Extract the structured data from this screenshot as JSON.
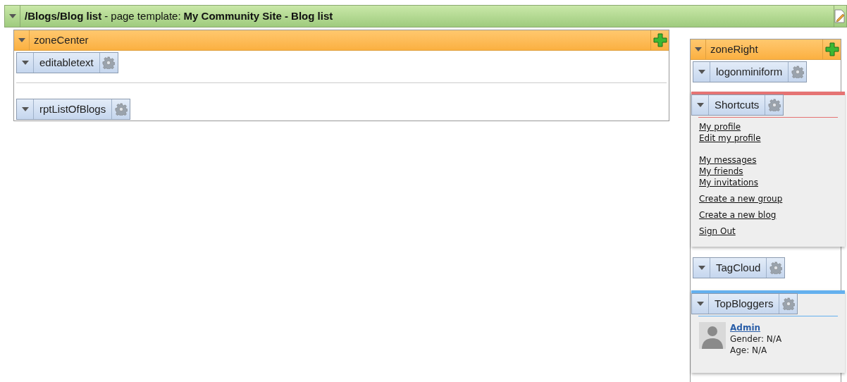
{
  "header": {
    "path": "/Blogs/Blog list",
    "separator": " - page template: ",
    "template": "My Community Site - Blog list"
  },
  "zone_center": {
    "title": "zoneCenter",
    "webparts": [
      {
        "title": "editabletext"
      },
      {
        "title": "rptListOfBlogs"
      }
    ]
  },
  "zone_right": {
    "title": "zoneRight",
    "logon": {
      "title": "logonminiform"
    },
    "shortcuts": {
      "title": "Shortcuts",
      "groups": [
        [
          "My profile",
          "Edit my profile"
        ],
        [
          "My messages",
          "My friends",
          "My invitations"
        ],
        [
          "Create a new group"
        ],
        [
          "Create a new blog"
        ],
        [
          "Sign Out"
        ]
      ]
    },
    "tagcloud": {
      "title": "TagCloud"
    },
    "top_bloggers": {
      "title": "TopBloggers",
      "users": [
        {
          "name": "Admin",
          "gender": "Gender: N/A",
          "age": "Age: N/A"
        }
      ]
    }
  }
}
